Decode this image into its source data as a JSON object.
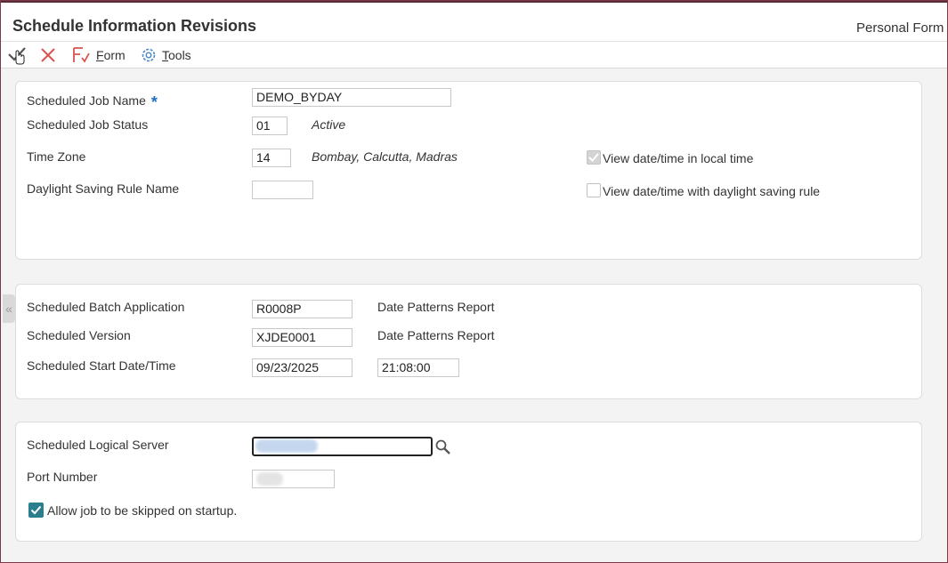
{
  "header": {
    "title": "Schedule Information Revisions",
    "personal_form_label": "Personal Form"
  },
  "toolbar": {
    "ok_icon": "checkmark-icon",
    "cancel_icon": "close-icon",
    "form_label": "Form",
    "tools_label": "Tools"
  },
  "panel1": {
    "job_name_label": "Scheduled Job Name",
    "job_name_required": "*",
    "job_name_value": "DEMO_BYDAY",
    "job_status_label": "Scheduled Job Status",
    "job_status_value": "01",
    "job_status_desc": "Active",
    "time_zone_label": "Time Zone",
    "time_zone_value": "14",
    "time_zone_desc": "Bombay, Calcutta, Madras",
    "dst_rule_label": "Daylight Saving Rule Name",
    "dst_rule_value": "",
    "local_time_label": "View date/time in local time",
    "local_time_checked": true,
    "local_time_disabled": true,
    "dst_view_label": "View date/time with daylight saving rule",
    "dst_view_checked": false
  },
  "panel2": {
    "batch_app_label": "Scheduled Batch Application",
    "batch_app_value": "R0008P",
    "batch_app_desc": "Date Patterns Report",
    "version_label": "Scheduled Version",
    "version_value": "XJDE0001",
    "version_desc": "Date Patterns Report",
    "start_label": "Scheduled Start Date/Time",
    "start_date_value": "09/23/2025",
    "start_time_value": "21:08:00"
  },
  "panel3": {
    "server_label": "Scheduled Logical Server",
    "port_label": "Port Number",
    "skip_label": "Allow job to be skipped on startup.",
    "skip_checked": true
  },
  "colors": {
    "required": "#1f6fc3",
    "checkbox_on": "#2b7e8e",
    "cancel": "#d9534f",
    "form_icon": "#d9534f",
    "tools_icon": "#4a86c7"
  }
}
